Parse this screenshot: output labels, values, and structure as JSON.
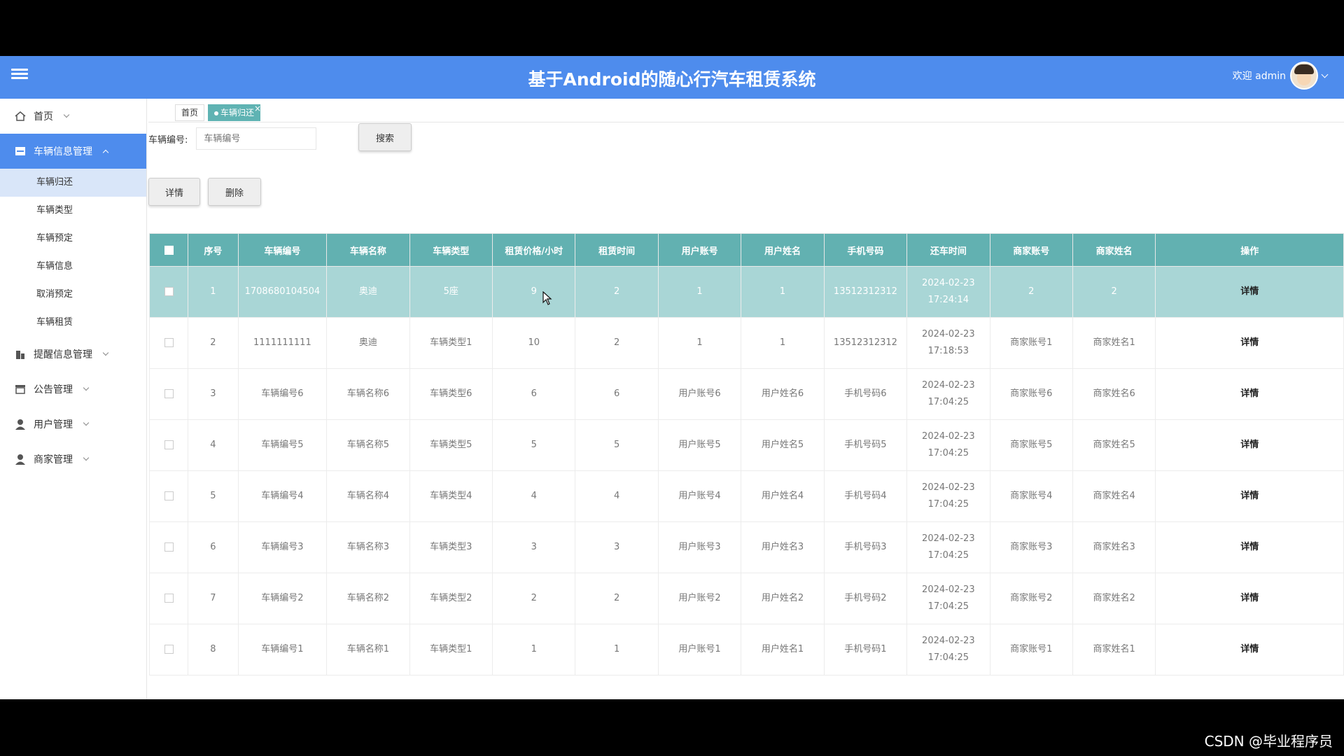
{
  "header": {
    "title": "基于Android的随心行汽车租赁系统",
    "welcome": "欢迎 admin"
  },
  "sidebar": {
    "items": [
      {
        "label": "首页",
        "icon": "home-icon"
      },
      {
        "label": "车辆信息管理",
        "icon": "store-icon",
        "sub": [
          "车辆归还",
          "车辆类型",
          "车辆预定",
          "车辆信息",
          "取消预定",
          "车辆租赁"
        ]
      },
      {
        "label": "提醒信息管理",
        "icon": "building-icon"
      },
      {
        "label": "公告管理",
        "icon": "notice-icon"
      },
      {
        "label": "用户管理",
        "icon": "user-icon"
      },
      {
        "label": "商家管理",
        "icon": "merchant-icon"
      }
    ]
  },
  "tabs": {
    "home": "首页",
    "active": "车辆归还",
    "close": "×"
  },
  "search": {
    "label": "车辆编号:",
    "placeholder": "车辆编号",
    "button": "搜索"
  },
  "actions": {
    "detail": "详情",
    "delete": "删除"
  },
  "table": {
    "headers": [
      "序号",
      "车辆编号",
      "车辆名称",
      "车辆类型",
      "租赁价格/小时",
      "租赁时间",
      "用户账号",
      "用户姓名",
      "手机号码",
      "还车时间",
      "商家账号",
      "商家姓名",
      "操作"
    ],
    "rows": [
      [
        "1",
        "1708680104504",
        "奥迪",
        "5座",
        "9",
        "2",
        "1",
        "1",
        "13512312312",
        "2024-02-23 17:24:14",
        "2",
        "2",
        "详情"
      ],
      [
        "2",
        "1111111111",
        "奥迪",
        "车辆类型1",
        "10",
        "2",
        "1",
        "1",
        "13512312312",
        "2024-02-23 17:18:53",
        "商家账号1",
        "商家姓名1",
        "详情"
      ],
      [
        "3",
        "车辆编号6",
        "车辆名称6",
        "车辆类型6",
        "6",
        "6",
        "用户账号6",
        "用户姓名6",
        "手机号码6",
        "2024-02-23 17:04:25",
        "商家账号6",
        "商家姓名6",
        "详情"
      ],
      [
        "4",
        "车辆编号5",
        "车辆名称5",
        "车辆类型5",
        "5",
        "5",
        "用户账号5",
        "用户姓名5",
        "手机号码5",
        "2024-02-23 17:04:25",
        "商家账号5",
        "商家姓名5",
        "详情"
      ],
      [
        "5",
        "车辆编号4",
        "车辆名称4",
        "车辆类型4",
        "4",
        "4",
        "用户账号4",
        "用户姓名4",
        "手机号码4",
        "2024-02-23 17:04:25",
        "商家账号4",
        "商家姓名4",
        "详情"
      ],
      [
        "6",
        "车辆编号3",
        "车辆名称3",
        "车辆类型3",
        "3",
        "3",
        "用户账号3",
        "用户姓名3",
        "手机号码3",
        "2024-02-23 17:04:25",
        "商家账号3",
        "商家姓名3",
        "详情"
      ],
      [
        "7",
        "车辆编号2",
        "车辆名称2",
        "车辆类型2",
        "2",
        "2",
        "用户账号2",
        "用户姓名2",
        "手机号码2",
        "2024-02-23 17:04:25",
        "商家账号2",
        "商家姓名2",
        "详情"
      ],
      [
        "8",
        "车辆编号1",
        "车辆名称1",
        "车辆类型1",
        "1",
        "1",
        "用户账号1",
        "用户姓名1",
        "手机号码1",
        "2024-02-23 17:04:25",
        "商家账号1",
        "商家姓名1",
        "详情"
      ]
    ]
  },
  "watermark": "CSDN @毕业程序员",
  "colors": {
    "header": "#4e8ced",
    "table_header": "#62b1b1",
    "selected_row": "#a9d6d6",
    "active_tab": "#5fb3b3"
  }
}
